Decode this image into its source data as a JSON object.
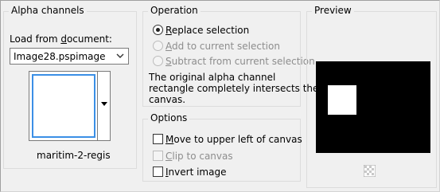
{
  "alpha_channels": {
    "title": "Alpha channels",
    "load_label_prefix": "Load from ",
    "load_label_key": "d",
    "load_label_suffix": "ocument:",
    "document_select": "Image28.pspimage",
    "thumbnail_caption": "maritim-2-regis"
  },
  "operation": {
    "title": "Operation",
    "replace_key": "R",
    "replace_rest": "eplace selection",
    "add_key": "A",
    "add_rest": "dd to current selection",
    "subtract_key": "S",
    "subtract_rest": "ubtract from current selection",
    "selected": "replace",
    "info_line1": "The original alpha channel",
    "info_line2": "rectangle completely intersects the",
    "info_line3": "canvas."
  },
  "options": {
    "title": "Options",
    "move_key": "M",
    "move_rest": "ove to upper left of canvas",
    "clip_key": "C",
    "clip_rest": "lip to canvas",
    "invert_key": "I",
    "invert_rest": "nvert image",
    "move_checked": false,
    "clip_checked": false,
    "invert_checked": false
  },
  "preview": {
    "title": "Preview"
  }
}
